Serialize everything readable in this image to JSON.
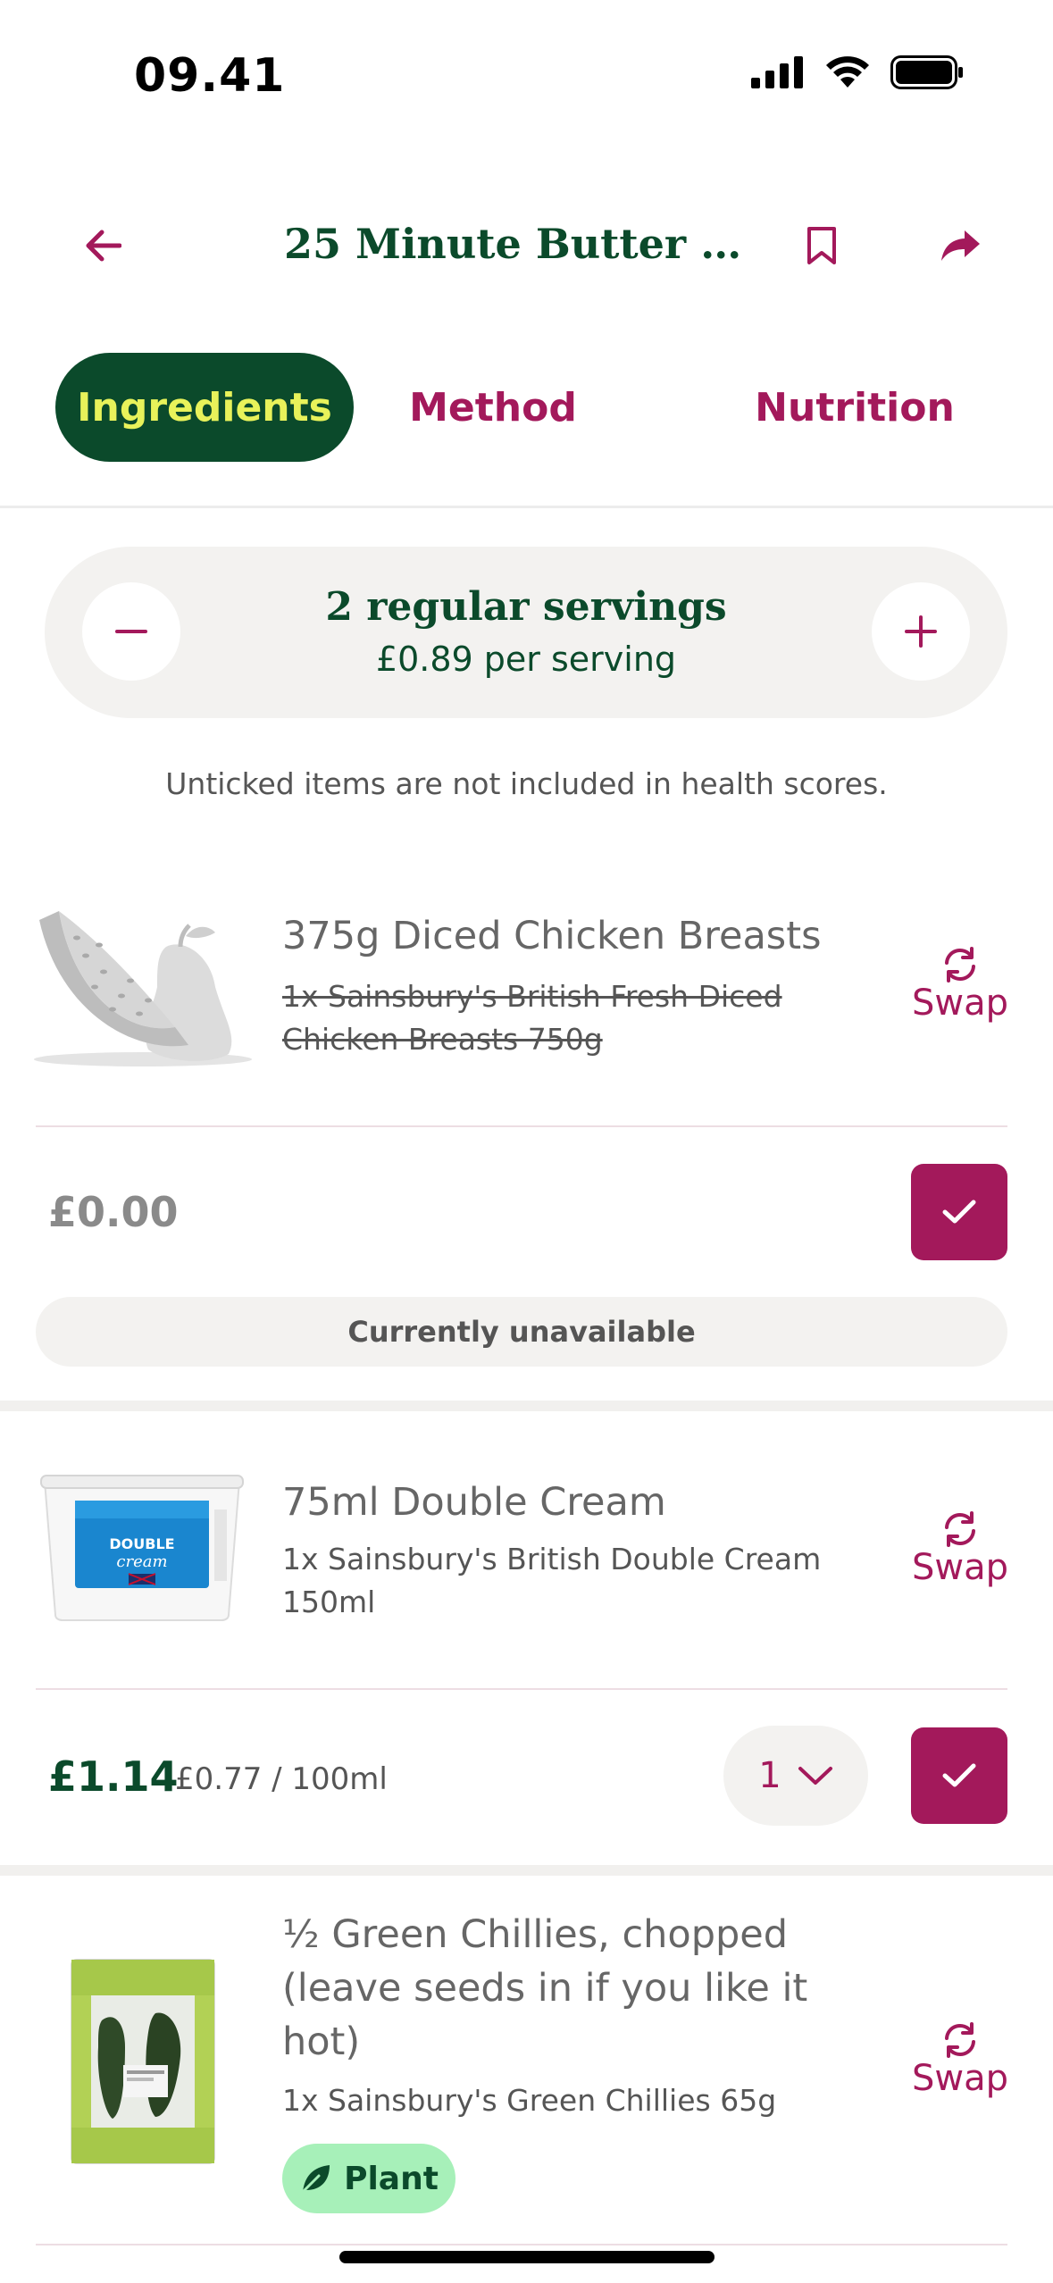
{
  "status_bar": {
    "time": "09.41"
  },
  "header": {
    "title": "25 Minute Butter Ch..."
  },
  "tabs": [
    {
      "label": "Ingredients",
      "active": true
    },
    {
      "label": "Method",
      "active": false
    },
    {
      "label": "Nutrition",
      "active": false
    }
  ],
  "servings": {
    "title": "2 regular servings",
    "price": "£0.89 per serving"
  },
  "note": "Unticked items are not included in health scores.",
  "ingredients": [
    {
      "name": "375g Diced Chicken Breasts",
      "product_line1": "1x Sainsbury's British Fresh Diced",
      "product_line2": "Chicken Breasts 750g",
      "swap_label": "Swap",
      "price": "£0.00",
      "status": "Currently unavailable",
      "checked": true
    },
    {
      "name": "75ml Double Cream",
      "product_line1": "1x Sainsbury's British Double Cream",
      "product_line2": "150ml",
      "swap_label": "Swap",
      "price": "£1.14",
      "unit_price": "£0.77 / 100ml",
      "quantity": "1",
      "checked": true
    },
    {
      "name_line1": "½ Green Chillies, chopped",
      "name_line2": "(leave seeds in if you like it",
      "name_line3": "hot)",
      "product": "1x Sainsbury's Green Chillies 65g",
      "swap_label": "Swap",
      "badge": "Plant"
    }
  ],
  "colors": {
    "brand_green": "#0b4a2b",
    "accent": "#a3195b",
    "tab_text_active": "#e8f25a",
    "plant_badge": "#a7f0b9"
  }
}
